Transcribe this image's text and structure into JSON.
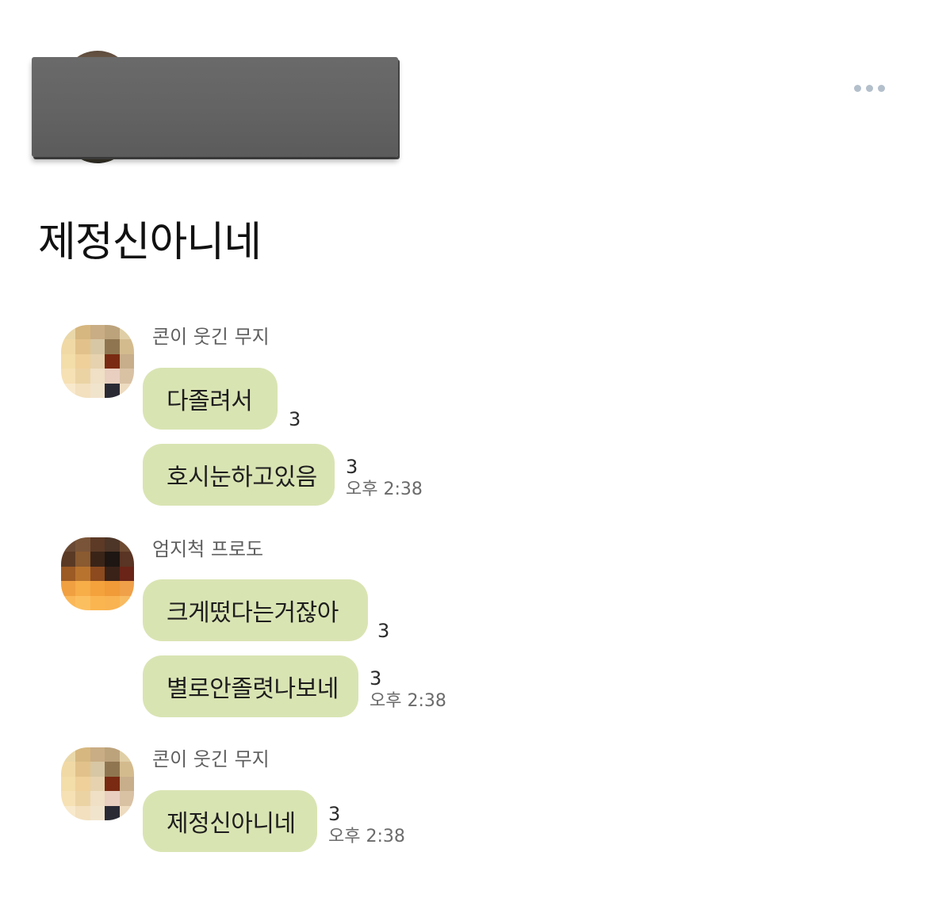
{
  "header": {
    "author_name": "",
    "more_icon": "more-horizontal-icon"
  },
  "post": {
    "text": "제정신아니네"
  },
  "chat": {
    "bubble_color": "#d9e4b3",
    "groups": [
      {
        "sender": "콘이 웃긴 무지",
        "messages": [
          {
            "text": "다졸려서",
            "unread": "3",
            "time": ""
          },
          {
            "text": "호시눈하고있음",
            "unread": "3",
            "time": "오후 2:38"
          }
        ]
      },
      {
        "sender": "엄지척 프로도",
        "messages": [
          {
            "text": "크게떴다는거잖아",
            "unread": "3",
            "time": ""
          },
          {
            "text": "별로안졸렷나보네",
            "unread": "3",
            "time": "오후 2:38"
          }
        ]
      },
      {
        "sender": "콘이 웃긴 무지",
        "messages": [
          {
            "text": "제정신아니네",
            "unread": "3",
            "time": "오후 2:38"
          }
        ]
      }
    ]
  }
}
